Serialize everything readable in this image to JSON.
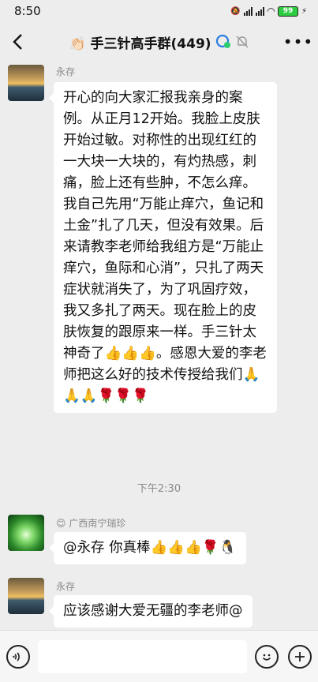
{
  "status": {
    "time": "8:50",
    "battery": "99"
  },
  "header": {
    "title": "👏🏻 手三针高手群(449)"
  },
  "messages": [
    {
      "sender": "永存",
      "text": "开心的向大家汇报我亲身的案例。从正月12开始。我脸上皮肤开始过敏。对称性的出现红红的一大块一大块的，有灼热感，刺痛，脸上还有些肿，不怎么痒。我自己先用“万能止痒穴，鱼记和土金”扎了几天，但没有效果。后来请教李老师给我组方是“万能止痒穴，鱼际和心消”，只扎了两天症状就消失了，为了巩固疗效，我又多扎了两天。现在脸上的皮肤恢复的跟原来一样。手三针太神奇了👍👍👍。感恩大爱的李老师把这么好的技术传授给我们🙏🙏🙏🌹🌹🌹"
    },
    {
      "sender": "😊 广西南宁瑞珍",
      "text": "@永存 你真棒👍👍👍🌹🐧"
    },
    {
      "sender": "永存",
      "text": "应该感谢大爱无疆的李老师@"
    }
  ],
  "timestamp": "下午2:30",
  "input": {
    "placeholder": ""
  },
  "icons": {
    "back": "chevron-left",
    "more": "more-dots",
    "voice": "voice-icon",
    "emoji": "emoji-icon",
    "plus": "plus-icon"
  }
}
